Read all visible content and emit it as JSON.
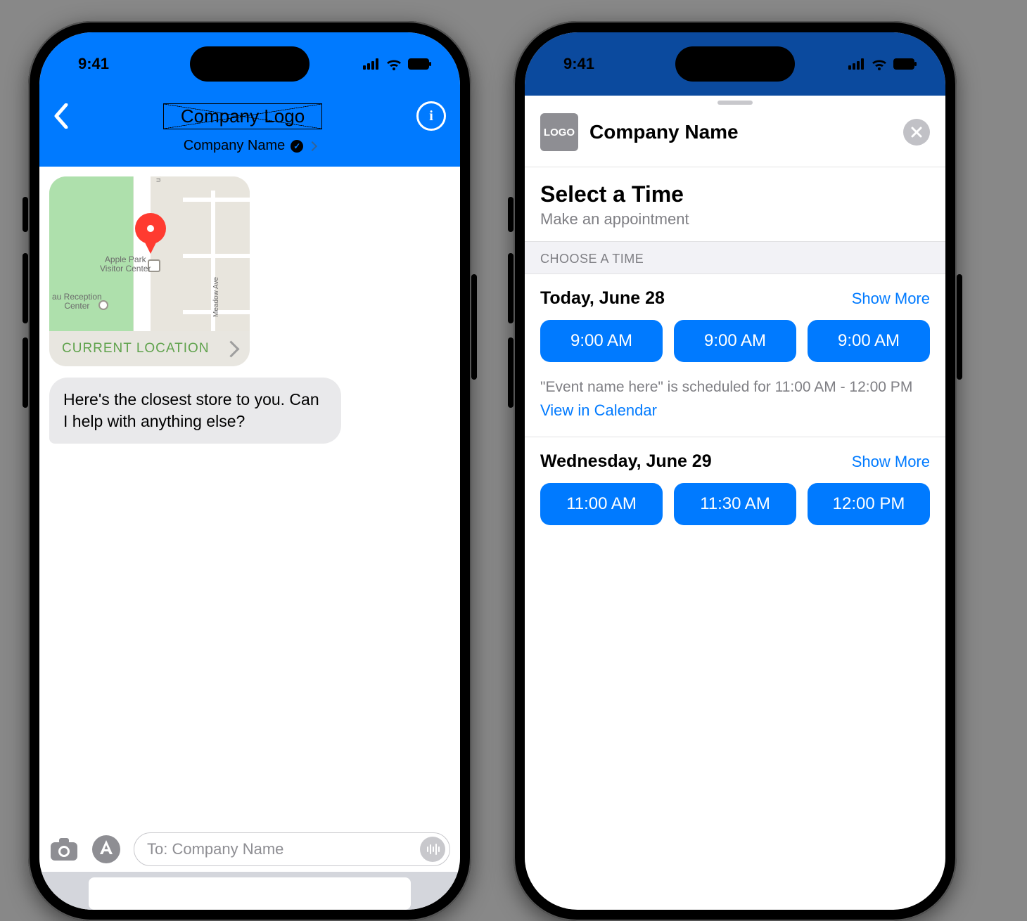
{
  "status": {
    "time": "9:41"
  },
  "left": {
    "logo_placeholder": "Company Logo",
    "company_name_line": "Company Name",
    "map": {
      "footer_label": "CURRENT LOCATION",
      "poi1_line1": "Apple Park",
      "poi1_line2": "Visitor Center",
      "poi2_line1": "au Reception",
      "poi2_line2": "Center",
      "road1": "u Ave",
      "road2": "Meadow Ave"
    },
    "message": "Here's the closest store to you. Can I help with anything else?",
    "input_placeholder": "To: Company Name"
  },
  "right": {
    "logo_text": "LOGO",
    "company_name": "Company Name",
    "title": "Select a Time",
    "subtitle": "Make an appointment",
    "section_label": "CHOOSE A TIME",
    "days": [
      {
        "label": "Today, June 28",
        "show_more": "Show More",
        "slots": [
          "9:00 AM",
          "9:00 AM",
          "9:00 AM"
        ],
        "event_note": "\"Event name here\" is scheduled for 11:00 AM - 12:00 PM",
        "view_cal": "View in Calendar"
      },
      {
        "label": "Wednesday, June 29",
        "show_more": "Show More",
        "slots": [
          "11:00 AM",
          "11:30 AM",
          "12:00 PM"
        ]
      }
    ]
  }
}
